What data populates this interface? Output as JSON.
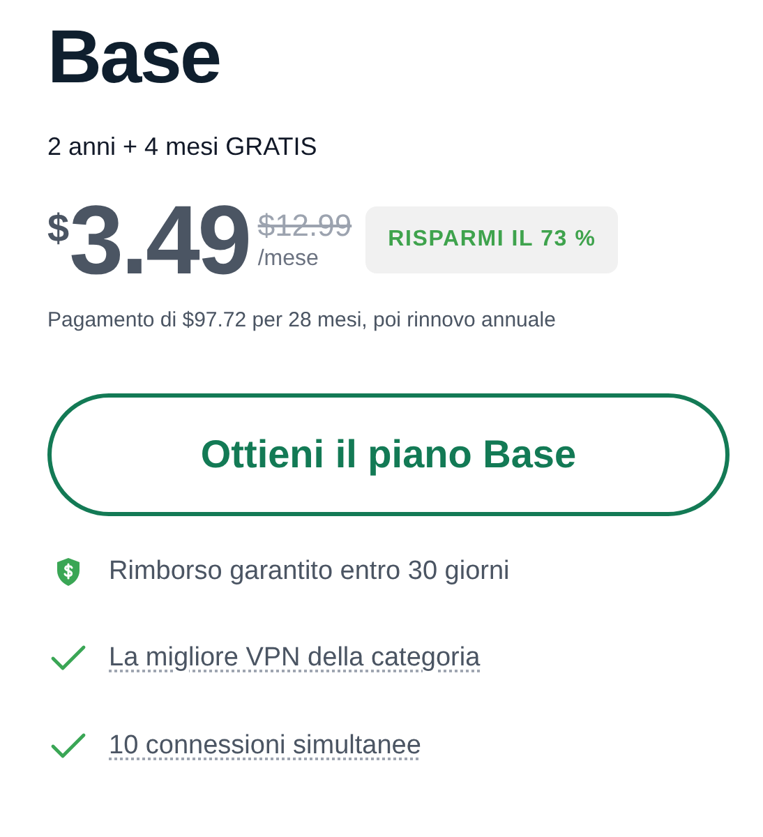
{
  "plan": {
    "title": "Base",
    "subtitle": "2 anni + 4 mesi GRATIS"
  },
  "price": {
    "currency": "$",
    "amount": "3.49",
    "old_price": "$12.99",
    "period": "/mese",
    "badge": "RISPARMI IL 73 %"
  },
  "billing_note": "Pagamento di $97.72 per 28 mesi, poi rinnovo annuale",
  "cta": {
    "label": "Ottieni il piano Base"
  },
  "features": [
    {
      "kind": "guarantee",
      "text": "Rimborso garantito entro 30 giorni"
    },
    {
      "kind": "check",
      "text": "La migliore VPN della categoria"
    },
    {
      "kind": "check",
      "text": "10 connessioni simultanee"
    }
  ]
}
